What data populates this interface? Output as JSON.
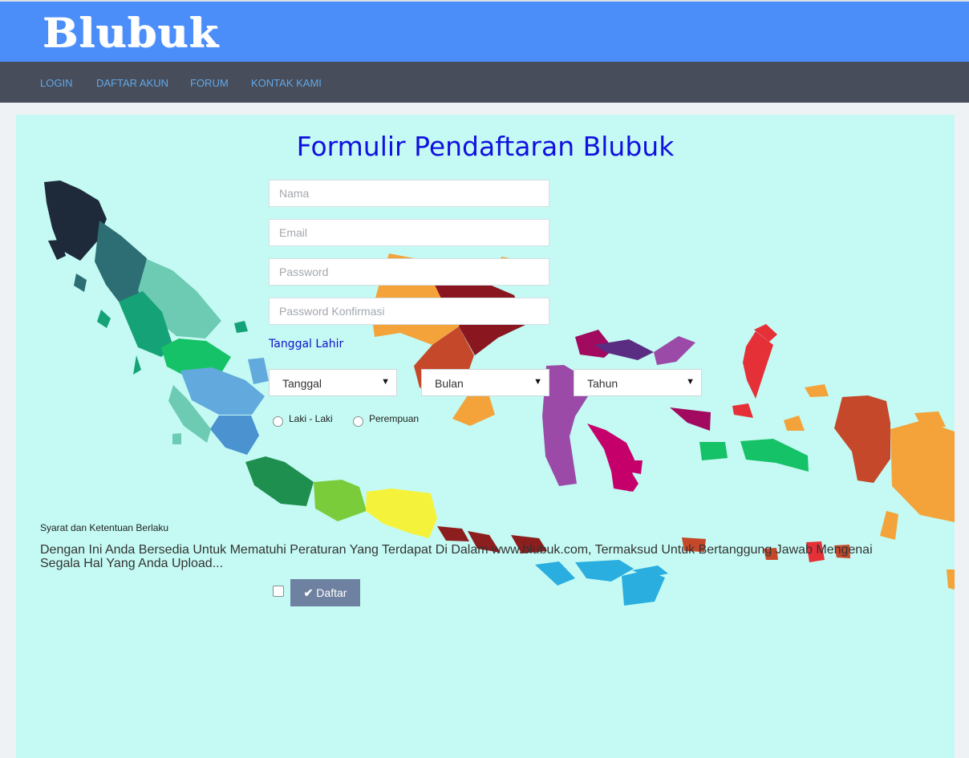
{
  "brand": {
    "logo_text": "Blubuk"
  },
  "nav": {
    "items": [
      "LOGIN",
      "DAFTAR AKUN",
      "FORUM",
      "KONTAK KAMI"
    ]
  },
  "form": {
    "title": "Formulir Pendaftaran Blubuk",
    "name_placeholder": "Nama",
    "email_placeholder": "Email",
    "password_placeholder": "Password",
    "password_confirm_placeholder": "Password Konfirmasi",
    "birthdate_label": "Tanggal Lahir",
    "day_select": "Tanggal",
    "month_select": "Bulan",
    "year_select": "Tahun",
    "gender_male": "Laki - Laki",
    "gender_female": "Perempuan",
    "terms_title": "Syarat dan Ketentuan Berlaku",
    "terms_text": "Dengan Ini Anda Bersedia Untuk Mematuhi Peraturan Yang Terdapat Di Dalam www.blubuk.com, Termaksud Untuk Bertanggung Jawab Mengenai Segala Hal Yang Anda Upload...",
    "submit_label": "Daftar"
  },
  "icons": {
    "submit_icon": "check-icon",
    "select_icon": "caret-down-icon",
    "background": "indonesia-map-illustration"
  },
  "colors": {
    "header": "#4b8ef9",
    "navbar": "#474d5a",
    "nav_link": "#62a8e8",
    "panel": "#c4faf3",
    "title": "#1010e0",
    "button": "#6e81a0"
  }
}
